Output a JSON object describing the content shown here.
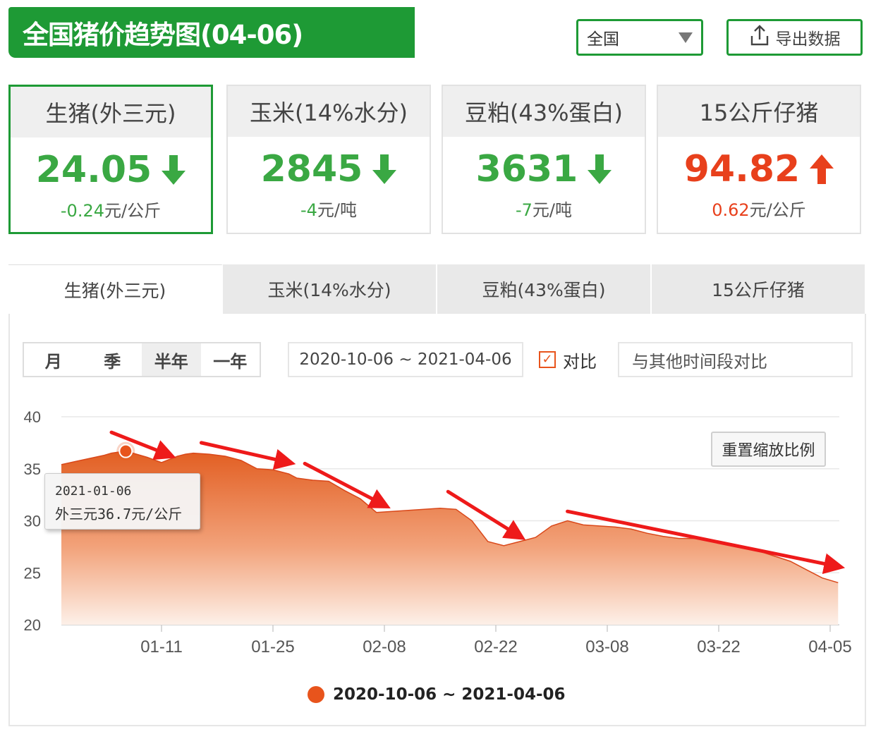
{
  "header": {
    "title": "全国猪价趋势图(04-06)",
    "region": "全国",
    "export_label": "导出数据"
  },
  "cards": [
    {
      "name": "生猪(外三元)",
      "value": "24.05",
      "direction": "down",
      "change_num": "-0.24",
      "change_unit": "元/公斤"
    },
    {
      "name": "玉米(14%水分)",
      "value": "2845",
      "direction": "down",
      "change_num": "-4",
      "change_unit": "元/吨"
    },
    {
      "name": "豆粕(43%蛋白)",
      "value": "3631",
      "direction": "down",
      "change_num": "-7",
      "change_unit": "元/吨"
    },
    {
      "name": "15公斤仔猪",
      "value": "94.82",
      "direction": "up",
      "change_num": "0.62",
      "change_unit": "元/公斤"
    }
  ],
  "tabs": [
    "生猪(外三元)",
    "玉米(14%水分)",
    "豆粕(43%蛋白)",
    "15公斤仔猪"
  ],
  "controls": {
    "ranges": [
      "月",
      "季",
      "半年",
      "一年"
    ],
    "active_range": "半年",
    "date_range": "2020-10-06 ~ 2021-04-06",
    "compare_label": "对比",
    "compare_checked": true,
    "compare_placeholder": "与其他时间段对比",
    "reset_zoom": "重置缩放比例"
  },
  "tooltip": {
    "date": "2021-01-06",
    "value_text": "外三元36.7元/公斤"
  },
  "colors": {
    "brand_green": "#1e9a35",
    "down_green": "#3aa843",
    "up_red": "#e8401c",
    "series_orange": "#e8541c",
    "arrow_red": "#ee1a1a"
  },
  "chart_data": {
    "type": "area",
    "ylim": [
      20,
      40
    ],
    "yticks": [
      "20",
      "25",
      "30",
      "35",
      "40"
    ],
    "xticks": [
      "01-11",
      "01-25",
      "02-08",
      "02-22",
      "03-08",
      "03-22",
      "04-05"
    ],
    "legend": "2020-10-06 ~ 2021-04-06",
    "legend_position": "bottom",
    "grid": true,
    "series": [
      {
        "name": "2020-10-06 ~ 2021-04-06",
        "x": [
          "12-28",
          "12-30",
          "01-01",
          "01-03",
          "01-04",
          "01-05",
          "01-06",
          "01-07",
          "01-09",
          "01-11",
          "01-13",
          "01-14",
          "01-15",
          "01-17",
          "01-19",
          "01-21",
          "01-23",
          "01-25",
          "01-27",
          "01-28",
          "01-30",
          "02-01",
          "02-03",
          "02-05",
          "02-07",
          "02-09",
          "02-11",
          "02-13",
          "02-15",
          "02-17",
          "02-19",
          "02-21",
          "02-23",
          "02-25",
          "02-27",
          "03-01",
          "03-03",
          "03-05",
          "03-07",
          "03-09",
          "03-11",
          "03-13",
          "03-15",
          "03-17",
          "03-19",
          "03-21",
          "03-23",
          "03-25",
          "03-27",
          "03-29",
          "03-31",
          "04-02",
          "04-04",
          "04-06"
        ],
        "y": [
          35.4,
          35.7,
          36.0,
          36.3,
          36.5,
          36.6,
          36.7,
          36.5,
          36.1,
          35.6,
          36.2,
          36.4,
          36.5,
          36.4,
          36.2,
          35.8,
          35.0,
          34.9,
          34.5,
          34.1,
          33.9,
          33.8,
          32.9,
          32.1,
          30.8,
          30.9,
          31.0,
          31.1,
          31.2,
          31.1,
          30.0,
          28.0,
          27.6,
          28.0,
          28.4,
          29.5,
          30.0,
          29.6,
          29.5,
          29.4,
          29.2,
          28.8,
          28.5,
          28.3,
          28.3,
          28.1,
          27.7,
          27.4,
          27.1,
          26.6,
          26.1,
          25.3,
          24.5,
          24.05
        ]
      }
    ],
    "annotations": [
      {
        "type": "arrow",
        "from": [
          "01-04",
          38.5
        ],
        "to": [
          "01-12",
          36.3
        ]
      },
      {
        "type": "arrow",
        "from": [
          "01-16",
          37.5
        ],
        "to": [
          "01-27",
          35.6
        ]
      },
      {
        "type": "arrow",
        "from": [
          "01-29",
          35.5
        ],
        "to": [
          "02-08",
          31.5
        ]
      },
      {
        "type": "arrow",
        "from": [
          "02-16",
          32.8
        ],
        "to": [
          "02-25",
          28.5
        ]
      },
      {
        "type": "arrow",
        "from": [
          "03-03",
          30.9
        ],
        "to": [
          "04-06",
          25.6
        ]
      }
    ]
  }
}
